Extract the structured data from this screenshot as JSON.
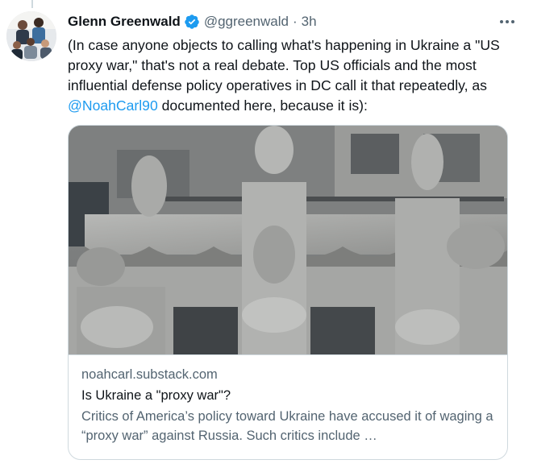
{
  "tweet": {
    "author_name": "Glenn Greenwald",
    "handle": "@ggreenwald",
    "separator": "·",
    "time": "3h",
    "text_before": "(In case anyone objects to calling what's happening in Ukraine a \"US proxy war,\" that's not a real debate. Top US officials and the most influential defense policy operatives in DC call it that repeatedly, as ",
    "mention": "@NoahCarl90",
    "text_after": " documented here, because it is):"
  },
  "card": {
    "domain": "noahcarl.substack.com",
    "title": "Is Ukraine a \"proxy war\"?",
    "description": "Critics of America’s policy toward Ukraine have accused it of waging a “proxy war” against Russia. Such critics include …",
    "image": "ornate-building-facade-with-animal-sculptures"
  },
  "icons": {
    "verified": "verified-badge-icon",
    "more": "more-options-icon"
  },
  "colors": {
    "link": "#1d9bf0",
    "secondary_text": "#536471",
    "border": "#cfd9de",
    "primary_text": "#0f1419"
  }
}
